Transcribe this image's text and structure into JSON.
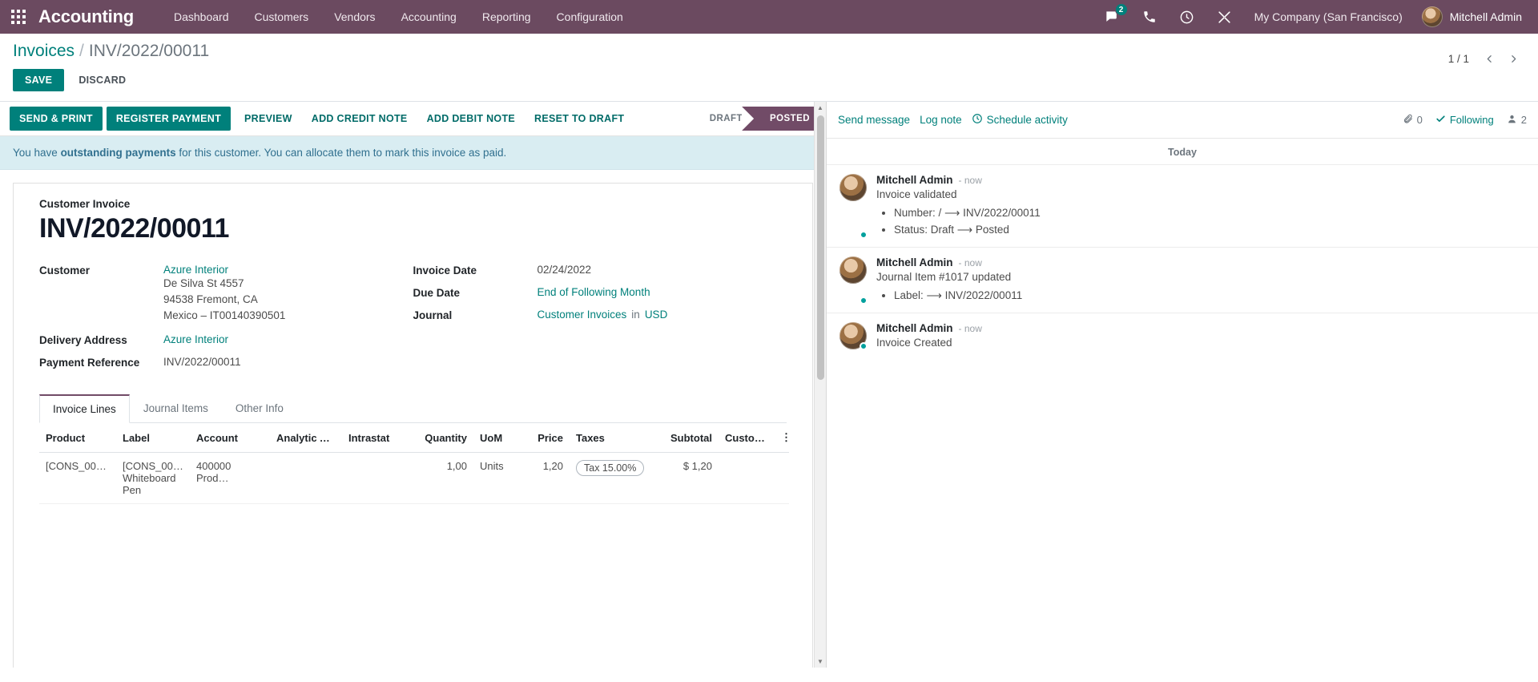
{
  "navbar": {
    "apps_icon": "apps-grid-icon",
    "brand": "Accounting",
    "menu": [
      {
        "label": "Dashboard"
      },
      {
        "label": "Customers"
      },
      {
        "label": "Vendors"
      },
      {
        "label": "Accounting"
      },
      {
        "label": "Reporting"
      },
      {
        "label": "Configuration"
      }
    ],
    "systray": {
      "messages_icon": "messages-icon",
      "messages_count": "2",
      "phone_icon": "phone-icon",
      "activity_icon": "clock-icon",
      "debug_icon": "wrench-icon"
    },
    "company": "My Company (San Francisco)",
    "user": "Mitchell Admin",
    "accent_purple": "#6B4A60",
    "accent_teal": "#00807B"
  },
  "control_panel": {
    "breadcrumb_root": "Invoices",
    "breadcrumb_sep": "/",
    "breadcrumb_current": "INV/2022/00011",
    "save_label": "SAVE",
    "discard_label": "DISCARD",
    "pager_label": "1 / 1",
    "pager_prev_icon": "chevron-left-icon",
    "pager_next_icon": "chevron-right-icon"
  },
  "statusbar": {
    "buttons": [
      {
        "label": "SEND & PRINT",
        "primary": true
      },
      {
        "label": "REGISTER PAYMENT",
        "primary": true
      },
      {
        "label": "PREVIEW",
        "primary": false
      },
      {
        "label": "ADD CREDIT NOTE",
        "primary": false
      },
      {
        "label": "ADD DEBIT NOTE",
        "primary": false
      },
      {
        "label": "RESET TO DRAFT",
        "primary": false
      }
    ],
    "states": [
      {
        "label": "DRAFT",
        "active": false
      },
      {
        "label": "POSTED",
        "active": true
      }
    ]
  },
  "alert": {
    "prefix": "You have ",
    "bold": "outstanding payments",
    "suffix": " for this customer. You can allocate them to mark this invoice as paid."
  },
  "sheet": {
    "subtitle": "Customer Invoice",
    "title": "INV/2022/00011",
    "left_fields": {
      "customer_label": "Customer",
      "customer_value": "Azure Interior",
      "customer_address": [
        "De Silva St 4557",
        "94538 Fremont, CA",
        "Mexico – IT00140390501"
      ],
      "delivery_label": "Delivery Address",
      "delivery_value": "Azure Interior",
      "payment_ref_label": "Payment Reference",
      "payment_ref_value": "INV/2022/00011"
    },
    "right_fields": {
      "invoice_date_label": "Invoice Date",
      "invoice_date_value": "02/24/2022",
      "due_date_label": "Due Date",
      "due_date_value": "End of Following Month",
      "journal_label": "Journal",
      "journal_value": "Customer Invoices",
      "journal_in": "in",
      "journal_currency": "USD"
    }
  },
  "notebook": {
    "tabs": [
      {
        "label": "Invoice Lines",
        "active": true
      },
      {
        "label": "Journal Items",
        "active": false
      },
      {
        "label": "Other Info",
        "active": false
      }
    ]
  },
  "lines_table": {
    "columns": [
      {
        "label": "Product",
        "align": "left"
      },
      {
        "label": "Label",
        "align": "left"
      },
      {
        "label": "Account",
        "align": "left"
      },
      {
        "label": "Analytic A…",
        "align": "left"
      },
      {
        "label": "Intrastat",
        "align": "left"
      },
      {
        "label": "Quantity",
        "align": "right"
      },
      {
        "label": "UoM",
        "align": "left"
      },
      {
        "label": "Price",
        "align": "right"
      },
      {
        "label": "Taxes",
        "align": "left"
      },
      {
        "label": "Subtotal",
        "align": "right"
      },
      {
        "label": "Custom…",
        "align": "left"
      }
    ],
    "rows": [
      {
        "product": "[CONS_0001…",
        "label": "[CONS_0001] Whiteboard Pen",
        "account": "400000 Prod…",
        "analytic": "",
        "intrastat": "",
        "quantity": "1,00",
        "uom": "Units",
        "price": "1,20",
        "taxes": "Tax 15.00%",
        "subtotal": "$ 1,20",
        "custom": ""
      }
    ]
  },
  "chatter": {
    "send_message": "Send message",
    "log_note": "Log note",
    "schedule_activity": "Schedule activity",
    "attachment_icon": "paperclip-icon",
    "attachment_count": "0",
    "following_label": "Following",
    "following_icon": "check-icon",
    "followers_icon": "user-icon",
    "followers_count": "2",
    "today_label": "Today",
    "messages": [
      {
        "author": "Mitchell Admin",
        "time": "- now",
        "text": "Invoice validated",
        "bullets": [
          "Number: / ⟶ INV/2022/00011",
          "Status: Draft ⟶ Posted"
        ]
      },
      {
        "author": "Mitchell Admin",
        "time": "- now",
        "text": "Journal Item #1017 updated",
        "bullets": [
          "Label: ⟶ INV/2022/00011"
        ]
      },
      {
        "author": "Mitchell Admin",
        "time": "- now",
        "text": "Invoice Created",
        "bullets": []
      }
    ]
  }
}
